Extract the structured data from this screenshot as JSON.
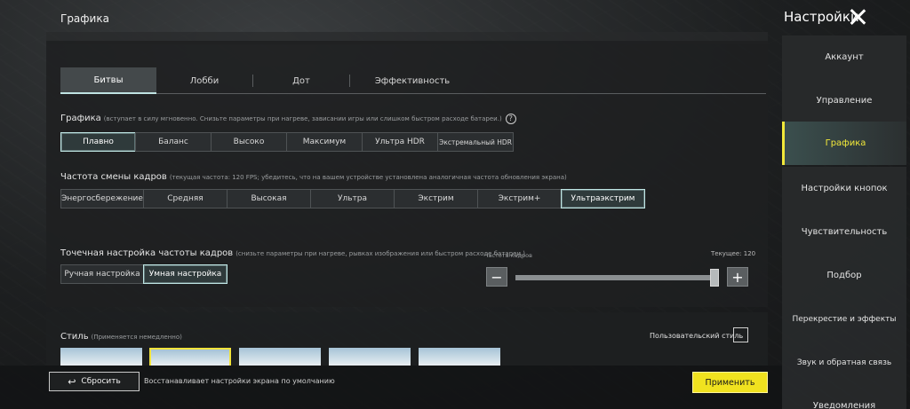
{
  "header": {
    "title": "Графика",
    "settings_title": "Настройки"
  },
  "tabs": [
    {
      "label": "Битвы",
      "active": true
    },
    {
      "label": "Лобби",
      "active": false
    },
    {
      "label": "Дот",
      "active": false
    },
    {
      "label": "Эффективность",
      "active": false
    }
  ],
  "graphics": {
    "label": "Графика",
    "note": "(вступает в силу мгновенно. Снизьте параметры при нагреве, зависании игры или слишком быстром расходе батареи.)",
    "options": [
      "Плавно",
      "Баланс",
      "Высоко",
      "Максимум",
      "Ультра HDR",
      "Экстремальный HDR"
    ],
    "selected": "Плавно"
  },
  "frame_rate": {
    "label": "Частота смены кадров",
    "note": "(текущая частота: 120 FPS; убедитесь, что на вашем устройстве установлена аналогичная частота обновления экрана)",
    "options": [
      "Энергосбережение",
      "Средняя",
      "Высокая",
      "Ультра",
      "Экстрим",
      "Экстрим+",
      "Ультраэкстрим"
    ],
    "selected": "Ультраэкстрим"
  },
  "fine_tune": {
    "label": "Точечная настройка частоты кадров",
    "note": "(снизьте параметры при нагреве, рывках изображения или быстром расходе батареи.)",
    "options": [
      "Ручная настройка",
      "Умная настройка"
    ],
    "selected": "Умная настройка",
    "freq_label": "Частота кадров",
    "current_label": "Текущее: 120",
    "minus": "−",
    "plus": "+",
    "slider_level": 1.0
  },
  "style": {
    "label": "Стиль",
    "note": "(Применяется немедленно)",
    "user_style_label": "Пользовательский стиль",
    "user_style_checked": false
  },
  "footer": {
    "reset_label": "Сбросить",
    "reset_icon": "undo-arrow-icon",
    "reset_desc": "Восстанавливает настройки экрана по умолчанию",
    "apply_label": "Применить"
  },
  "sidebar": {
    "items": [
      {
        "label": "Аккаунт",
        "active": false
      },
      {
        "label": "Управление",
        "active": false
      },
      {
        "label": "Графика",
        "active": true
      },
      {
        "label": "Настройки кнопок",
        "active": false
      },
      {
        "label": "Чувствительность",
        "active": false
      },
      {
        "label": "Подбор",
        "active": false
      },
      {
        "label": "Перекрестие и эффекты",
        "active": false
      },
      {
        "label": "Звук и обратная связь",
        "active": false
      },
      {
        "label": "Уведомления",
        "active": false
      }
    ]
  },
  "colors": {
    "accent_yellow": "#f0e21f",
    "selected_border": "#bfe6e4"
  }
}
